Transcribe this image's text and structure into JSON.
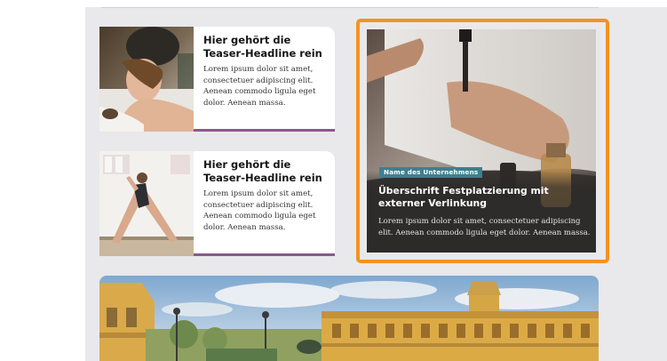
{
  "teasers": [
    {
      "headline": "Hier gehört die Teaser-Headline rein",
      "body": "Lorem ipsum dolor sit amet, consectetuer adipiscing elit. Aenean commodo ligula eget dolor. Aenean massa."
    },
    {
      "headline": "Hier gehört die Teaser-Headline rein",
      "body": "Lorem ipsum dolor sit amet, consectetuer adipiscing elit. Aenean commodo ligula eget dolor. Aenean massa."
    }
  ],
  "feature": {
    "badge": "Name des Unternehmens",
    "headline": "Überschrift Festplatzierung mit externer Verlinkung",
    "body": "Lorem ipsum dolor sit amet, consectetuer adipiscing elit. Aenean commodo ligula eget dolor. Aenean massa."
  },
  "colors": {
    "highlight_border": "#f5921f",
    "teaser_accent": "#8a5a8a",
    "badge_bg": "#3f7f8f",
    "page_bg": "#e9e9ec"
  },
  "images": {
    "teaser_1": "spa-massage-photo",
    "teaser_2": "yoga-pose-photo",
    "feature": "dropper-bottle-photo",
    "banner": "thermal-bath-palace-photo"
  }
}
